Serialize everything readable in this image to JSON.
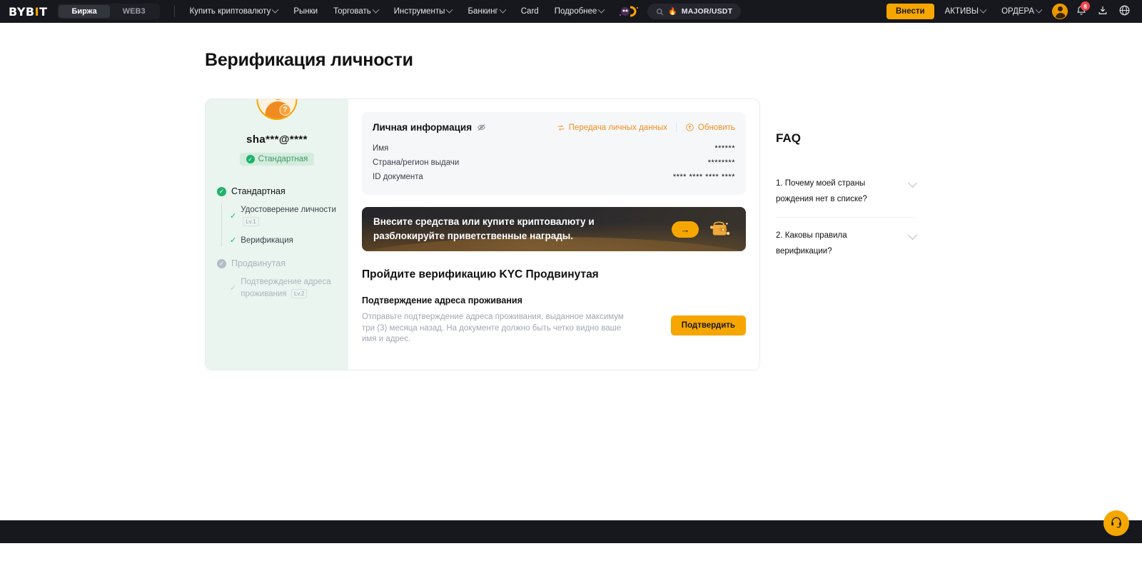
{
  "header": {
    "logo": "BYB",
    "logo_accent": "I",
    "logo_tail": "T",
    "segments": [
      {
        "label": "Биржа",
        "active": true
      },
      {
        "label": "WEB3",
        "active": false
      }
    ],
    "nav": [
      {
        "label": "Купить криптовалюту",
        "caret": true
      },
      {
        "label": "Рынки",
        "caret": false
      },
      {
        "label": "Торговать",
        "caret": true
      },
      {
        "label": "Инструменты",
        "caret": true
      },
      {
        "label": "Банкинг",
        "caret": true
      },
      {
        "label": "Card",
        "caret": false
      },
      {
        "label": "Подробнее",
        "caret": true
      }
    ],
    "search": {
      "icon": "search-icon",
      "term": "MAJOR/USDT",
      "flame": "🔥"
    },
    "deposit_label": "Внести",
    "assets_label": "АКТИВЫ",
    "orders_label": "ОРДЕРА",
    "notification_count": "8",
    "icons": [
      "avatar-icon",
      "bell-icon",
      "download-icon",
      "globe-icon"
    ]
  },
  "page": {
    "title": "Верификация личности"
  },
  "sidebar": {
    "email": "sha***@****",
    "level_badge": "Стандартная",
    "steps": [
      {
        "label": "Стандартная",
        "done": true,
        "items": [
          {
            "label": "Удостоверение личности",
            "tag": "Lv.1",
            "done": true
          },
          {
            "label": "Верификация",
            "tag": "",
            "done": true
          }
        ]
      },
      {
        "label": "Продвинутая",
        "done": false,
        "items": [
          {
            "label": "Подтверждение адреса проживания",
            "tag": "Lv.2",
            "done": false
          }
        ]
      }
    ]
  },
  "personal_info": {
    "title": "Личная информация",
    "eye_icon": "eye-off-icon",
    "action_share": "Передача личных данных",
    "action_update": "Обновить",
    "rows": [
      {
        "label": "Имя",
        "value": "******"
      },
      {
        "label": "Страна/регион выдачи",
        "value": "********"
      },
      {
        "label": "ID документа",
        "value": "**** **** **** ****"
      }
    ]
  },
  "banner": {
    "line1": "Внесите средства или купите криптовалюту и",
    "line2": "разблокируйте приветственные награды.",
    "cta_icon": "arrow-right-icon",
    "art_icon": "wallet-icon"
  },
  "kyc": {
    "title": "Пройдите верификацию KYC Продвинутая",
    "subtitle": "Подтверждение адреса проживания",
    "description": "Отправьте подтверждение адреса проживания, выданное максимум три (3) месяца назад. На документе должно быть четко видно ваше имя и адрес.",
    "button": "Подтвердить"
  },
  "faq": {
    "title": "FAQ",
    "items": [
      {
        "question": "1. Почему моей страны рождения нет в списке?"
      },
      {
        "question": "2. Каковы правила верификации?"
      }
    ]
  },
  "support": {
    "icon": "headset-icon"
  },
  "colors": {
    "accent": "#f7a600",
    "success": "#20b26c",
    "danger": "#ef454a",
    "dark": "#17181e",
    "mint": "#eaf5ef"
  }
}
